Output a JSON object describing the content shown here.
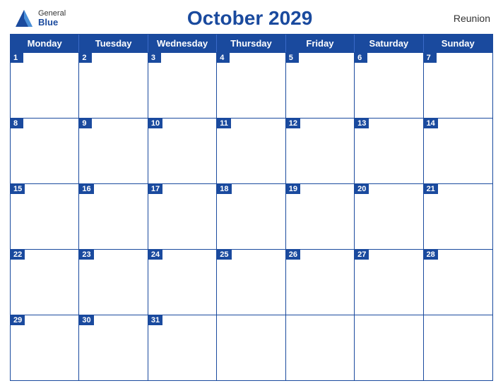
{
  "header": {
    "logo_general": "General",
    "logo_blue": "Blue",
    "title": "October 2029",
    "region": "Reunion"
  },
  "days": [
    "Monday",
    "Tuesday",
    "Wednesday",
    "Thursday",
    "Friday",
    "Saturday",
    "Sunday"
  ],
  "weeks": [
    [
      1,
      2,
      3,
      4,
      5,
      6,
      7
    ],
    [
      8,
      9,
      10,
      11,
      12,
      13,
      14
    ],
    [
      15,
      16,
      17,
      18,
      19,
      20,
      21
    ],
    [
      22,
      23,
      24,
      25,
      26,
      27,
      28
    ],
    [
      29,
      30,
      31,
      null,
      null,
      null,
      null
    ]
  ]
}
